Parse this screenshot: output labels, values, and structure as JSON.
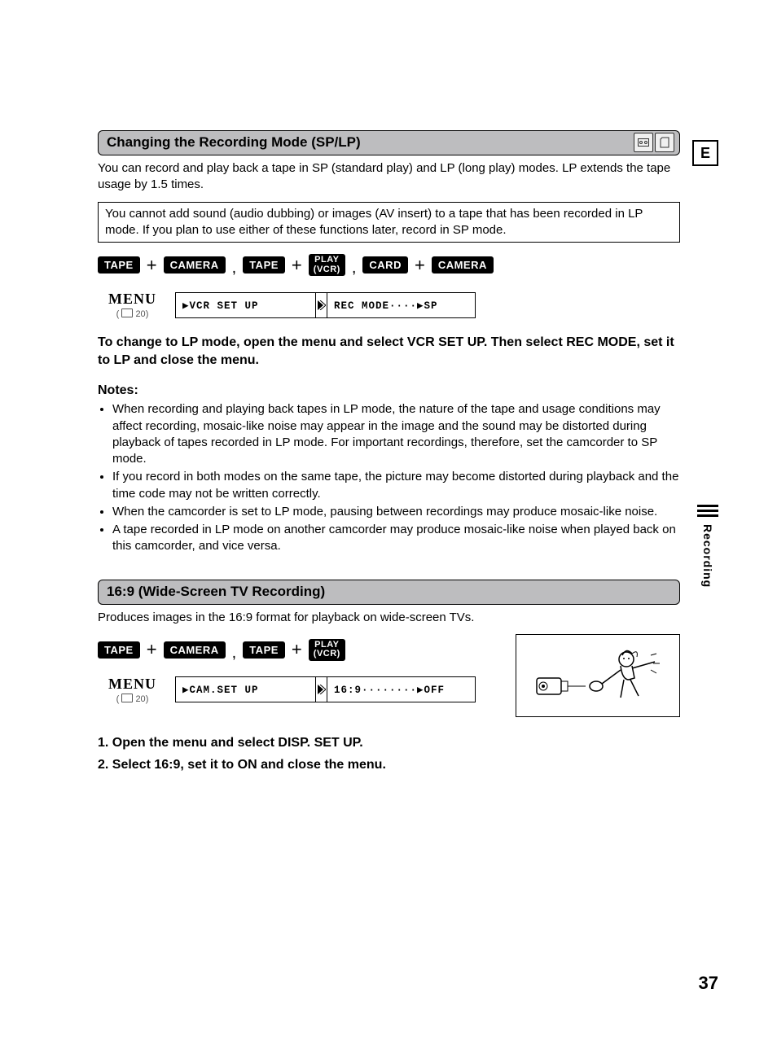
{
  "lang_indicator": "E",
  "side_tab": "Recording",
  "page_number": "37",
  "section1": {
    "title": "Changing the Recording Mode (SP/LP)",
    "intro": "You can record and play back a tape in SP (standard play) and LP (long play) modes. LP extends the tape usage by 1.5 times.",
    "warning": "You cannot add sound (audio dubbing) or images (AV insert) to a tape that has been recorded in LP mode. If you plan to use either of these functions later, record in SP mode.",
    "badges": {
      "tape": "TAPE",
      "camera": "CAMERA",
      "play_line1": "PLAY",
      "play_line2": "(VCR)",
      "card": "CARD"
    },
    "menu": {
      "label": "MENU",
      "ref": "20",
      "box1": "▶VCR SET UP",
      "box2": "REC MODE····▶SP"
    },
    "instruction": "To change to LP mode, open the menu and select VCR SET UP. Then select REC MODE, set it to LP and close the menu.",
    "notes_label": "Notes:",
    "notes": [
      "When recording and playing back tapes in LP mode, the nature of the tape and usage conditions may affect recording, mosaic-like noise may appear in the image and the sound may be distorted during playback of tapes recorded in LP mode. For important recordings, therefore, set the camcorder to SP mode.",
      "If you record in both modes on the same tape, the picture may become distorted during playback and the time code may not be written correctly.",
      "When the camcorder is set to LP mode, pausing between recordings may produce mosaic-like noise.",
      "A tape recorded in LP mode on another camcorder may produce mosaic-like noise when played back on this camcorder, and vice versa."
    ]
  },
  "section2": {
    "title": "16:9 (Wide-Screen TV Recording)",
    "intro": "Produces images in the 16:9 format for playback on wide-screen TVs.",
    "menu": {
      "label": "MENU",
      "ref": "20",
      "box1": "▶CAM.SET UP",
      "box2": "16:9········▶OFF"
    },
    "steps": [
      "1.  Open the menu and select DISP. SET UP.",
      "2.  Select 16:9, set it to ON and close the menu."
    ]
  }
}
